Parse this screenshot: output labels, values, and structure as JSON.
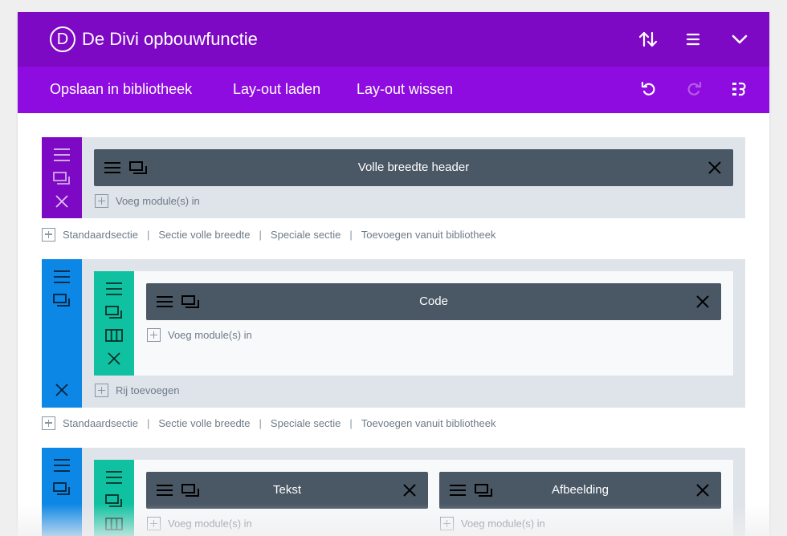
{
  "header": {
    "logo_letter": "D",
    "title": "De Divi opbouwfunctie"
  },
  "toolbar": {
    "save_library": "Opslaan in bibliotheek",
    "load_layout": "Lay-out laden",
    "clear_layout": "Lay-out wissen"
  },
  "sections": [
    {
      "modules": [
        {
          "label": "Volle breedte header"
        }
      ],
      "insert_module": "Voeg module(s) in"
    },
    {
      "modules": [
        {
          "label": "Code"
        }
      ],
      "insert_module": "Voeg module(s) in",
      "add_row": "Rij toevoegen"
    },
    {
      "modules": [
        {
          "label": "Tekst"
        },
        {
          "label": "Afbeelding"
        }
      ],
      "insert_module_left": "Voeg module(s) in",
      "insert_module_right": "Voeg module(s) in"
    }
  ],
  "add_section": {
    "standard": "Standaardsectie",
    "fullwidth": "Sectie volle breedte",
    "special": "Speciale sectie",
    "from_library": "Toevoegen vanuit bibliotheek",
    "separator": "|"
  },
  "colors": {
    "header": "#7e09c4",
    "toolbar": "#8f0ce0",
    "section_fullwidth": "#7e09c4",
    "section_regular": "#0d87e6",
    "row": "#10c1a1",
    "module": "#4a5765"
  }
}
